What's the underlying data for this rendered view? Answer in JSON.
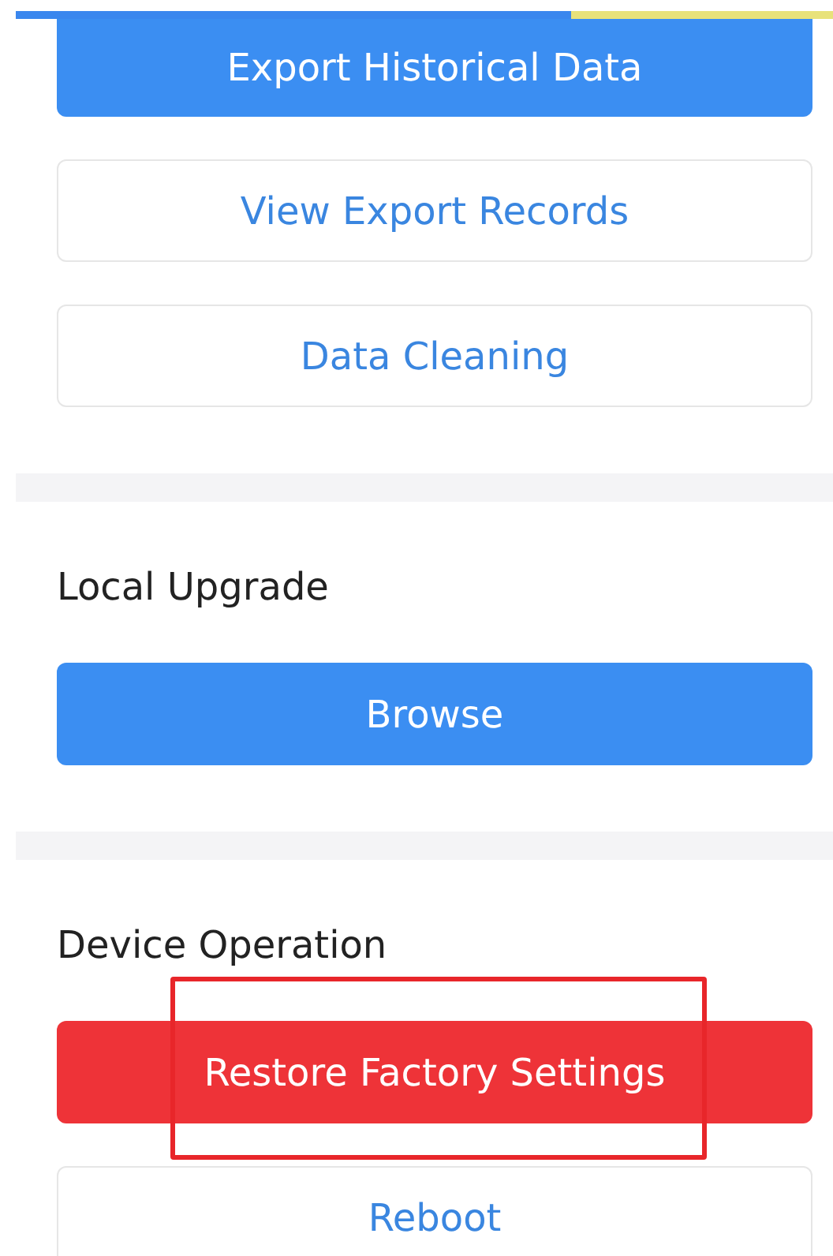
{
  "sections": [
    {
      "buttons": [
        {
          "label": "Export Historical Data",
          "kind": "primary",
          "highlighted": false
        },
        {
          "label": "View Export Records",
          "kind": "outline",
          "highlighted": false
        },
        {
          "label": "Data Cleaning",
          "kind": "outline",
          "highlighted": false
        }
      ]
    },
    {
      "title": "Local Upgrade",
      "buttons": [
        {
          "label": "Browse",
          "kind": "primary",
          "highlighted": false
        }
      ]
    },
    {
      "title": "Device Operation",
      "buttons": [
        {
          "label": "Restore Factory Settings",
          "kind": "danger",
          "highlighted": true
        },
        {
          "label": "Reboot",
          "kind": "outline",
          "highlighted": false
        }
      ]
    }
  ]
}
